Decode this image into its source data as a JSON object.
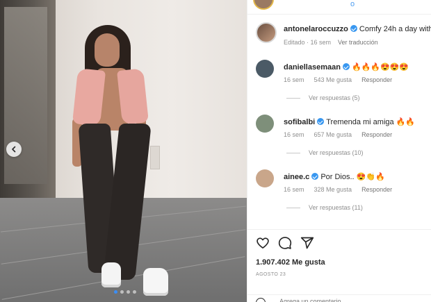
{
  "post": {
    "image_label": "",
    "carousel": {
      "total": 4,
      "active": 0
    }
  },
  "top_strip": {
    "text": "o"
  },
  "caption": {
    "username": "antonelaroccuzzo",
    "text": "Comfy 24h a day with",
    "edited": "Editado · 16 sem",
    "translate": "Ver traducción"
  },
  "comments": [
    {
      "username": "daniellasemaan",
      "text": "🔥🔥🔥😍😍😍",
      "time": "16 sem",
      "likes": "543 Me gusta",
      "reply": "Responder",
      "view_replies": "Ver respuestas (5)",
      "avatar_color": "#4b5a66"
    },
    {
      "username": "sofibalbi",
      "text": "Tremenda mi amiga 🔥🔥",
      "time": "16 sem",
      "likes": "657 Me gusta",
      "reply": "Responder",
      "view_replies": "Ver respuestas (10)",
      "avatar_color": "#7e8f7a"
    },
    {
      "username": "ainee.c",
      "text": "Por Dios.. 😍👏🔥",
      "time": "16 sem",
      "likes": "328 Me gusta",
      "reply": "Responder",
      "view_replies": "Ver respuestas (11)",
      "avatar_color": "#c9a68a"
    }
  ],
  "actions": {
    "icons": [
      "heart-icon",
      "comment-icon",
      "share-icon"
    ]
  },
  "likes": "1.907.402 Me gusta",
  "date": "AGOSTO 23",
  "composer": {
    "placeholder": "Agrega un comentario..."
  },
  "colors": {
    "verified": "#3897f0",
    "link": "#4c9cf0",
    "carousel_active_dot": "#3b8ef5"
  }
}
